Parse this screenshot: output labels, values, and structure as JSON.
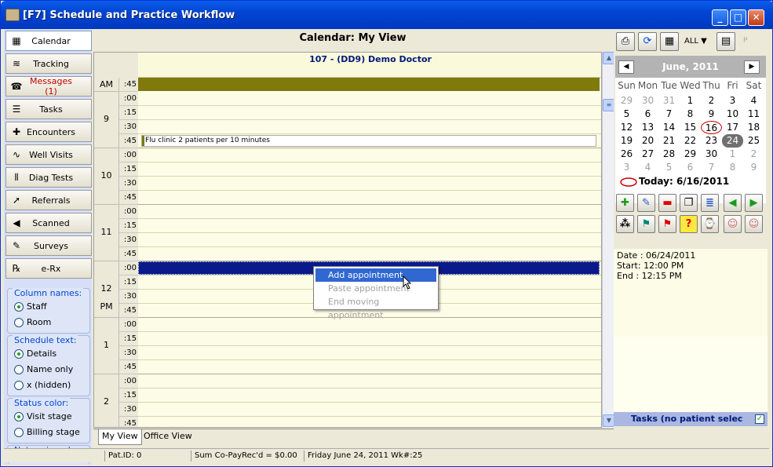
{
  "window": {
    "title": "[F7] Schedule and Practice Workflow",
    "min": "_",
    "max": "□",
    "close": "✕"
  },
  "nav": [
    {
      "label": "Calendar",
      "icon": "calendar-icon",
      "glyph": "▦"
    },
    {
      "label": "Tracking",
      "icon": "tracking-icon",
      "glyph": "≋"
    },
    {
      "label": "Messages (1)",
      "icon": "phone-icon",
      "glyph": "☎"
    },
    {
      "label": "Tasks",
      "icon": "tasks-icon",
      "glyph": "☰"
    },
    {
      "label": "Encounters",
      "icon": "encounters-icon",
      "glyph": "✚"
    },
    {
      "label": "Well Visits",
      "icon": "stethoscope-icon",
      "glyph": "∿"
    },
    {
      "label": "Diag Tests",
      "icon": "test-tubes-icon",
      "glyph": "⫴"
    },
    {
      "label": "Referrals",
      "icon": "referrals-icon",
      "glyph": "➚"
    },
    {
      "label": "Scanned",
      "icon": "scanned-icon",
      "glyph": "◀"
    },
    {
      "label": "Surveys",
      "icon": "surveys-icon",
      "glyph": "✎"
    },
    {
      "label": "e-Rx",
      "icon": "erx-icon",
      "glyph": "℞"
    }
  ],
  "groups": {
    "column_names": {
      "title": "Column names:",
      "options": [
        "Staff",
        "Room"
      ],
      "selected": "Staff"
    },
    "schedule_text": {
      "title": "Schedule text:",
      "options": [
        "Details",
        "Name only",
        "x (hidden)"
      ],
      "selected": "Details"
    },
    "status_color": {
      "title": "Status color:",
      "options": [
        "Visit stage",
        "Billing stage"
      ],
      "selected": "Visit stage"
    },
    "not_assigned": {
      "title": "Not assigned:"
    }
  },
  "calendar": {
    "header": "Calendar:  My View",
    "column_title": "107  - (DD9) Demo Doctor",
    "ampm_top": "AM",
    "ampm_pm": "PM",
    "hours": [
      "9",
      "10",
      "11",
      "12",
      "1",
      "2"
    ],
    "minutes": [
      ":00",
      ":15",
      ":30",
      ":45"
    ],
    "first_slot_min": ":45",
    "appointment": "Flu clinic 2 patients per 10 minutes"
  },
  "context_menu": {
    "items": [
      {
        "label": "Add appointment",
        "enabled": true
      },
      {
        "label": "Paste appointment",
        "enabled": false
      },
      {
        "label": "End moving appointment",
        "enabled": false
      }
    ]
  },
  "tabs": [
    "My View",
    "Office View"
  ],
  "status": {
    "patid": "Pat.ID: 0",
    "copay": "Sum Co-PayRec'd = $0.00",
    "date": "Friday  June 24, 2011 Wk#:25"
  },
  "toolbar": {
    "all_label": "ALL",
    "p_label": "P"
  },
  "mini_calendar": {
    "month": "June, 2011",
    "prev": "◀",
    "next": "▶",
    "dow": [
      "Sun",
      "Mon",
      "Tue",
      "Wed",
      "Thu",
      "Fri",
      "Sat"
    ],
    "weeks": [
      [
        [
          "29",
          true
        ],
        [
          "30",
          true
        ],
        [
          "31",
          true
        ],
        [
          "1",
          false
        ],
        [
          "2",
          false
        ],
        [
          "3",
          false
        ],
        [
          "4",
          false
        ]
      ],
      [
        [
          "5",
          false
        ],
        [
          "6",
          false
        ],
        [
          "7",
          false
        ],
        [
          "8",
          false
        ],
        [
          "9",
          false
        ],
        [
          "10",
          false
        ],
        [
          "11",
          false
        ]
      ],
      [
        [
          "12",
          false
        ],
        [
          "13",
          false
        ],
        [
          "14",
          false
        ],
        [
          "15",
          false
        ],
        [
          "16",
          false
        ],
        [
          "17",
          false
        ],
        [
          "18",
          false
        ]
      ],
      [
        [
          "19",
          false
        ],
        [
          "20",
          false
        ],
        [
          "21",
          false
        ],
        [
          "22",
          false
        ],
        [
          "23",
          false
        ],
        [
          "24",
          false
        ],
        [
          "25",
          false
        ]
      ],
      [
        [
          "26",
          false
        ],
        [
          "27",
          false
        ],
        [
          "28",
          false
        ],
        [
          "29",
          false
        ],
        [
          "30",
          false
        ],
        [
          "1",
          true
        ],
        [
          "2",
          true
        ]
      ],
      [
        [
          "3",
          true
        ],
        [
          "4",
          true
        ],
        [
          "5",
          true
        ],
        [
          "6",
          true
        ],
        [
          "7",
          true
        ],
        [
          "8",
          true
        ],
        [
          "9",
          true
        ]
      ]
    ],
    "today_day": "16",
    "selected_day": "24",
    "today_text": "Today: 6/16/2011"
  },
  "detail": {
    "date": "Date : 06/24/2011",
    "start": "Start: 12:00 PM",
    "end": "End : 12:15 PM"
  },
  "tasks_label": "Tasks (no patient selec",
  "colors": {
    "olive": "#807a0a",
    "navy": "#0b1a8a",
    "today_circle": "#d00000"
  }
}
